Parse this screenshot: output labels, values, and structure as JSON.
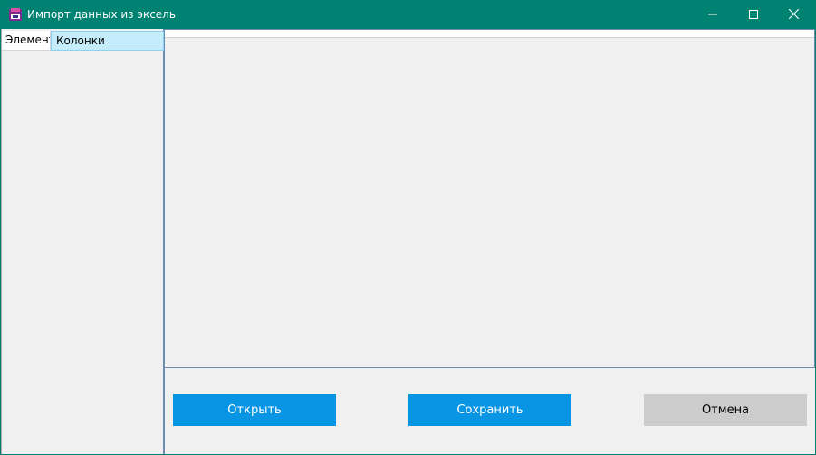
{
  "window": {
    "title": "Импорт данных из эксель",
    "icon": "app-icon",
    "controls": {
      "minimize": "minimize-icon",
      "maximize": "maximize-icon",
      "close": "close-icon"
    }
  },
  "list_view": {
    "columns": [
      "Элемент",
      "Колонки"
    ]
  },
  "buttons": {
    "open": "Открыть",
    "save": "Сохранить",
    "cancel": "Отмена"
  },
  "colors": {
    "titlebar": "#008272",
    "primary_button": "#0896e4",
    "secondary_button": "#cccccc"
  }
}
